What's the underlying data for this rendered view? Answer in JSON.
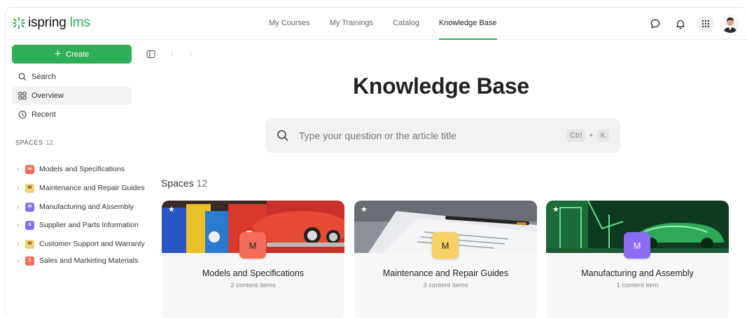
{
  "brand": {
    "name": "ispring",
    "suffix": "lms",
    "color": "#2fae57"
  },
  "nav": [
    {
      "label": "My Courses",
      "active": false
    },
    {
      "label": "My Trainings",
      "active": false
    },
    {
      "label": "Catalog",
      "active": false
    },
    {
      "label": "Knowledge Base",
      "active": true
    }
  ],
  "header_icons": [
    "chat-icon",
    "bell-icon",
    "apps-grid-icon",
    "user-avatar"
  ],
  "sidebar": {
    "create_label": "Create",
    "links": [
      {
        "label": "Search",
        "icon": "search-icon"
      },
      {
        "label": "Overview",
        "icon": "grid-icon",
        "active": true
      },
      {
        "label": "Recent",
        "icon": "clock-icon"
      }
    ],
    "spaces_label": "SPACES",
    "spaces_count": "12",
    "spaces": [
      {
        "label": "Models and Specifications",
        "badge": "M",
        "color": "#f26b5b"
      },
      {
        "label": "Maintenance and Repair Guides",
        "badge": "M",
        "color": "#f7d166"
      },
      {
        "label": "Manufacturing and Assembly",
        "badge": "M",
        "color": "#8a6cf2"
      },
      {
        "label": "Supplier and Parts Information",
        "badge": "S",
        "color": "#8a6cf2"
      },
      {
        "label": "Customer Support and Warranty",
        "badge": "M",
        "color": "#f7d166"
      },
      {
        "label": "Sales and Marketing Materials",
        "badge": "S",
        "color": "#f26b5b"
      }
    ]
  },
  "main": {
    "title": "Knowledge Base",
    "search_placeholder": "Type your question or the article title",
    "shortcut": {
      "key1": "Ctrl",
      "plus": "+",
      "key2": "K"
    },
    "spaces_title": "Spaces",
    "spaces_count": "12",
    "cards": [
      {
        "letter": "M",
        "title": "Models and Specifications",
        "sub": "2 content items",
        "color": "#f26b5b"
      },
      {
        "letter": "M",
        "title": "Maintenance and Repair Guides",
        "sub": "3 content items",
        "color": "#f7d166"
      },
      {
        "letter": "M",
        "title": "Manufacturing and Assembly",
        "sub": "1 content item",
        "color": "#8a6cf2"
      }
    ]
  }
}
